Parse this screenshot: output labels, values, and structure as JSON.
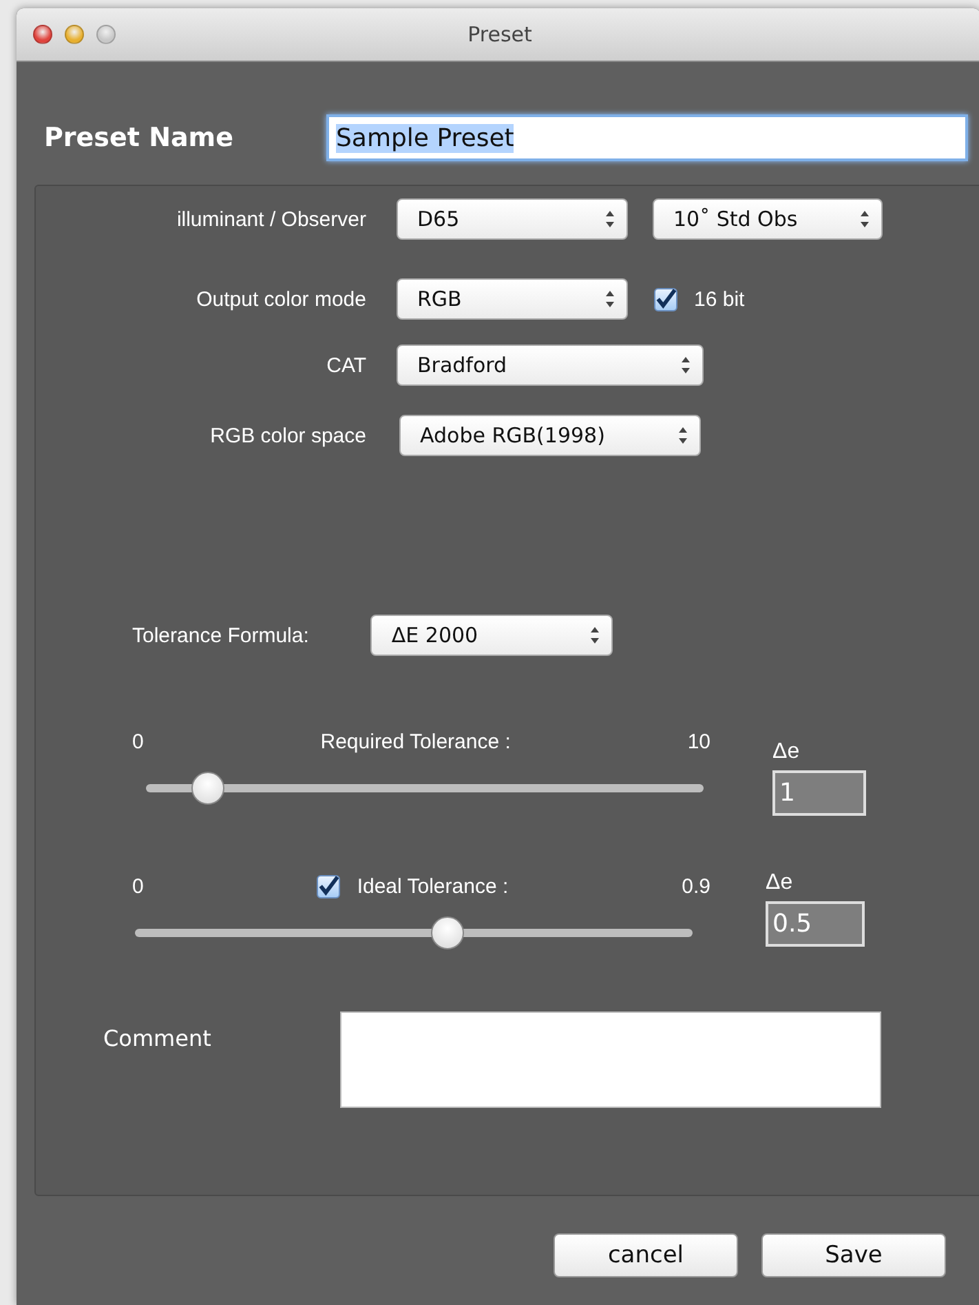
{
  "window": {
    "title": "Preset"
  },
  "preset_name": {
    "label": "Preset Name",
    "value": "Sample Preset",
    "text_selected": true
  },
  "illuminant_observer": {
    "label": "illuminant / Observer",
    "illuminant": "D65",
    "observer": "10˚ Std Obs"
  },
  "output_color_mode": {
    "label": "Output color mode",
    "value": "RGB",
    "checkbox": {
      "label": "16 bit",
      "checked": true
    }
  },
  "cat": {
    "label": "CAT",
    "value": "Bradford"
  },
  "rgb_color_space": {
    "label": "RGB color space",
    "value": "Adobe RGB(1998)"
  },
  "tolerance_formula": {
    "label": "Tolerance Formula:",
    "value": "ΔE 2000"
  },
  "sliders": [
    {
      "min_label": "0",
      "label": "Required Tolerance :",
      "max_label": "10",
      "level": 0.11,
      "unit": "Δe",
      "value": "1"
    },
    {
      "min_label": "0",
      "label": "Ideal Tolerance :",
      "max_label": "0.9",
      "level": 0.56,
      "unit": "Δe",
      "value": "0.5",
      "checked": true
    }
  ],
  "comment": {
    "label": "Comment"
  },
  "buttons": [
    "cancel",
    "Save"
  ]
}
